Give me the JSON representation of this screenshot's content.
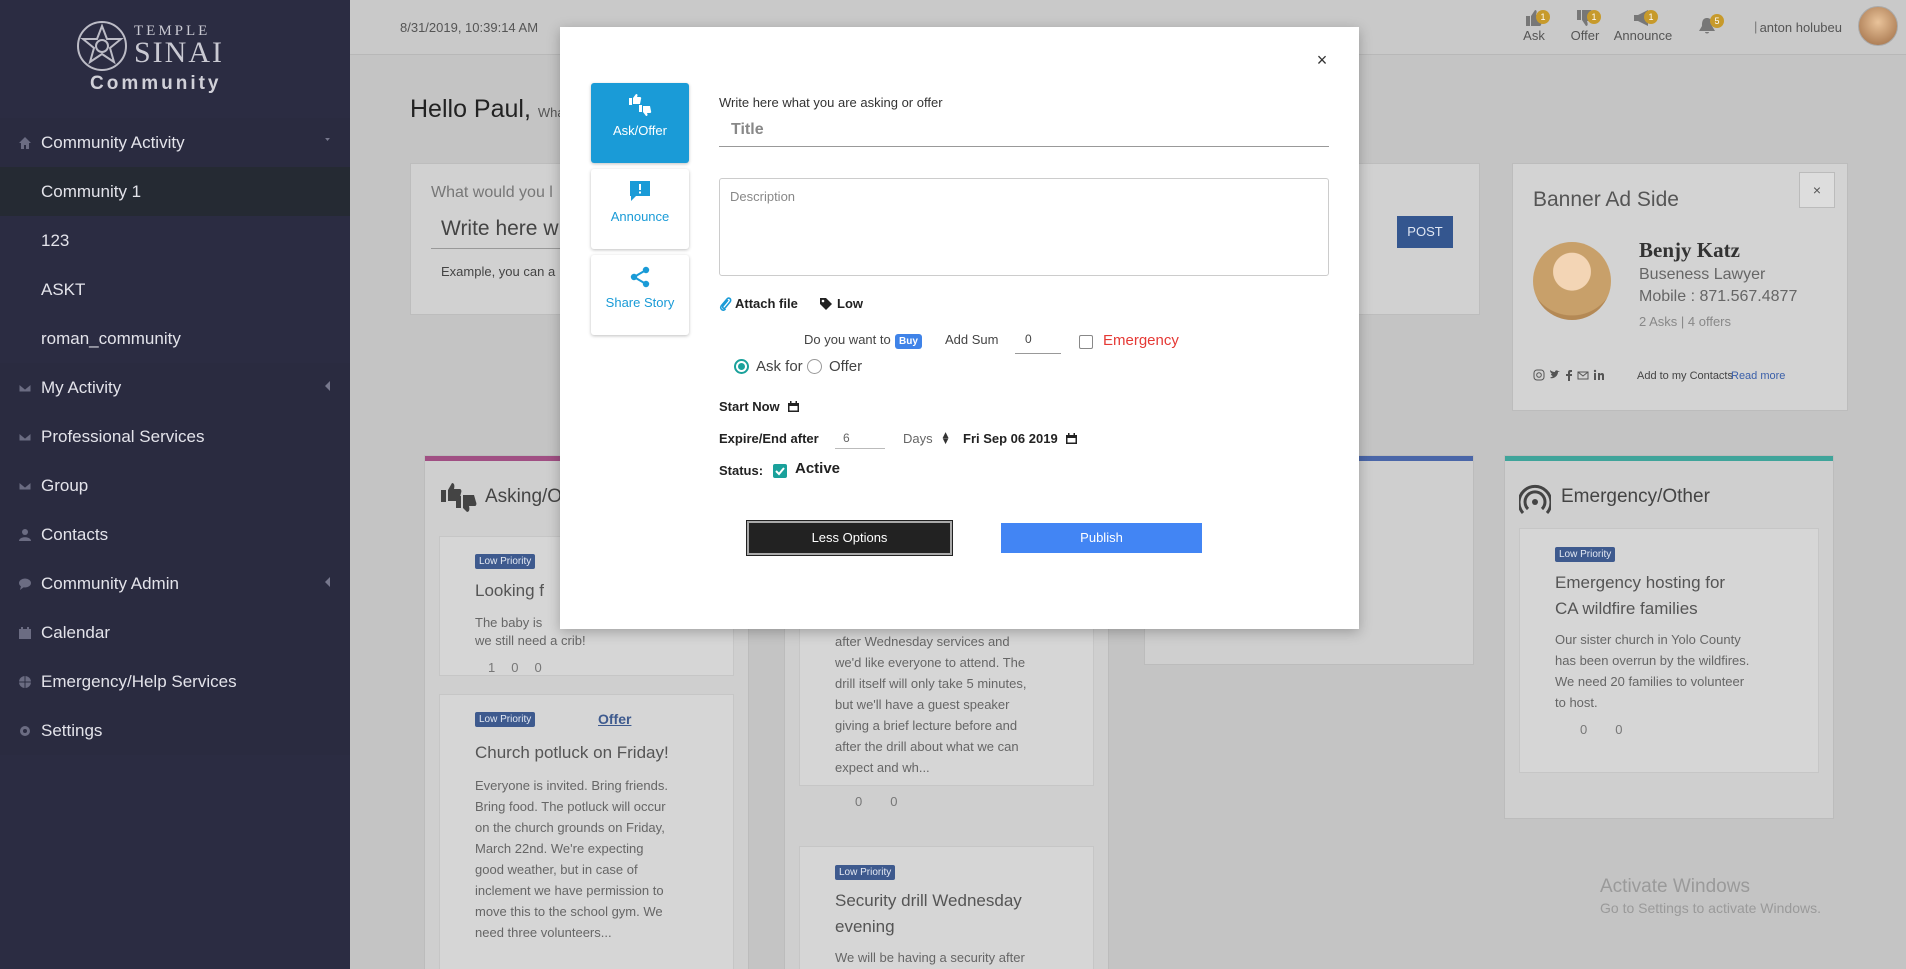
{
  "logo": {
    "line1": "TEMPLE",
    "line2": "SINAI",
    "line3": "Community"
  },
  "sidebar": {
    "items": [
      {
        "label": "Community Activity",
        "icon": "home-icon"
      },
      {
        "label": "Community 1"
      },
      {
        "label": "123"
      },
      {
        "label": "ASKT"
      },
      {
        "label": "roman_community"
      },
      {
        "label": "My Activity",
        "icon": "envelope-icon"
      },
      {
        "label": "Professional Services",
        "icon": "envelope-icon"
      },
      {
        "label": "Group",
        "icon": "envelope-icon"
      },
      {
        "label": "Contacts",
        "icon": "user-icon"
      },
      {
        "label": "Community Admin",
        "icon": "chat-icon"
      },
      {
        "label": "Calendar",
        "icon": "calendar-icon"
      },
      {
        "label": "Emergency/Help Services",
        "icon": "globe-icon"
      },
      {
        "label": "Settings",
        "icon": "gear-icon"
      }
    ]
  },
  "topbar": {
    "datetime": "8/31/2019, 10:39:14 AM",
    "actions": [
      {
        "label": "Ask",
        "badge": "1"
      },
      {
        "label": "Offer",
        "badge": "1"
      },
      {
        "label": "Announce",
        "badge": "1"
      }
    ],
    "bell_badge": "5",
    "separator": "|",
    "user_name": "anton holubeu"
  },
  "main": {
    "greeting": "Hello Paul,",
    "greeting_sub": "Wha",
    "post_question": "What would you l",
    "post_placeholder": "Write here w",
    "post_button": "POST",
    "post_example": "Example, you can a"
  },
  "banner": {
    "title": "Banner Ad Side",
    "close": "×",
    "name": "Benjy Katz",
    "role": "Buseness Lawyer",
    "mobile": "Mobile : 871.567.4877",
    "stats": "2 Asks | 4 offers",
    "add_contacts": "Add to my Contacts",
    "read_more": "Read more"
  },
  "columns": {
    "asking": {
      "title": "Asking/O",
      "cards": [
        {
          "priority": "Low Priority",
          "title": "Looking f",
          "text1": "The baby is",
          "text2": "we still need a crib!",
          "counts": [
            "1",
            "0",
            "0"
          ]
        },
        {
          "priority": "Low Priority",
          "tag": "Offer",
          "title": "Church potluck on Friday!",
          "lines": [
            "Everyone is invited. Bring friends.",
            "Bring food. The potluck will occur",
            "on the church grounds on Friday,",
            "March 22nd. We're expecting",
            "good weather, but in case of",
            "inclement we have permission to",
            "move this to the school gym. We",
            "need three volunteers..."
          ]
        }
      ]
    },
    "announce": {
      "card1_lines": [
        "after Wednesday services and",
        "we'd like everyone to attend. The",
        "drill itself will only take 5 minutes,",
        "but we'll have a guest speaker",
        "giving a brief lecture before and",
        "after the drill about what we can",
        "expect and wh..."
      ],
      "card1_counts": [
        "0",
        "0"
      ],
      "card2": {
        "priority": "Low Priority",
        "title1": "Security drill Wednesday",
        "title2": "evening",
        "text": "We will be having a security after"
      }
    },
    "emergency": {
      "title": "Emergency/Other",
      "card": {
        "priority": "Low Priority",
        "title1": "Emergency hosting for",
        "title2": "CA wildfire families",
        "lines": [
          "Our sister church in Yolo County",
          "has been overrun by the wildfires.",
          "We need 20 families to volunteer",
          "to host."
        ],
        "counts": [
          "0",
          "0"
        ]
      }
    },
    "fab": "+"
  },
  "watermark": {
    "line1": "Activate Windows",
    "line2": "Go to Settings to activate Windows."
  },
  "modal": {
    "close": "×",
    "tabs": [
      {
        "label": "Ask/Offer",
        "icon": "thumbs-icon"
      },
      {
        "label": "Announce",
        "icon": "announce-icon"
      },
      {
        "label": "Share Story",
        "icon": "share-icon"
      }
    ],
    "prompt": "Write here what you are asking or offer",
    "title_placeholder": "Title",
    "description_placeholder": "Description",
    "attach_label": "Attach file",
    "priority_label": "Low",
    "buy_prompt": "Do you want to",
    "buy_badge": "Buy",
    "add_sum_label": "Add Sum",
    "sum_value": "0",
    "emergency_label": "Emergency",
    "radio_ask": "Ask for",
    "radio_offer": "Offer",
    "start_label": "Start Now",
    "expire_label": "Expire/End after",
    "expire_value": "6",
    "days_label": "Days",
    "expire_date": "Fri Sep 06 2019",
    "status_label": "Status:",
    "status_value": "Active",
    "less_options": "Less Options",
    "publish": "Publish"
  }
}
